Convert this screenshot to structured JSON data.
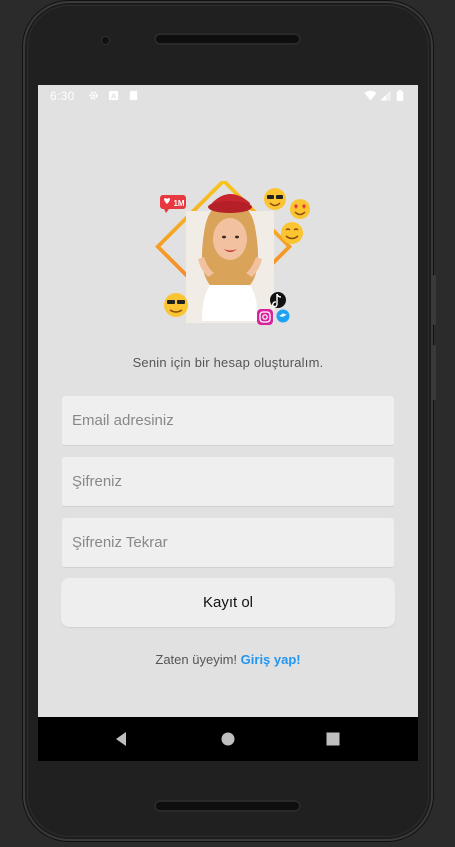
{
  "status_bar": {
    "time": "6:30",
    "left_icons": [
      "settings-icon",
      "notification-a-icon",
      "sd-card-icon"
    ],
    "right_icons": [
      "wifi-icon",
      "signal-icon",
      "battery-icon"
    ]
  },
  "hero": {
    "badge_text": "1M",
    "social_icons": [
      "instagram-icon",
      "tiktok-icon",
      "twitter-icon"
    ]
  },
  "form": {
    "subtitle": "Senin için bir hesap oluşturalım.",
    "email_placeholder": "Email adresiniz",
    "email_value": "",
    "password_placeholder": "Şifreniz",
    "password_value": "",
    "password_repeat_placeholder": "Şifreniz Tekrar",
    "password_repeat_value": "",
    "register_label": "Kayıt ol"
  },
  "login_prompt": {
    "text": "Zaten üyeyim!",
    "link": "Giriş yap!"
  },
  "colors": {
    "screen_bg": "#e1e1e1",
    "field_bg": "#efefef",
    "link": "#2196f3",
    "frame_orange": "#f5762a",
    "frame_yellow": "#f7c520"
  },
  "nav_bar": {
    "icons": [
      "back-triangle-icon",
      "home-circle-icon",
      "recents-square-icon"
    ]
  }
}
